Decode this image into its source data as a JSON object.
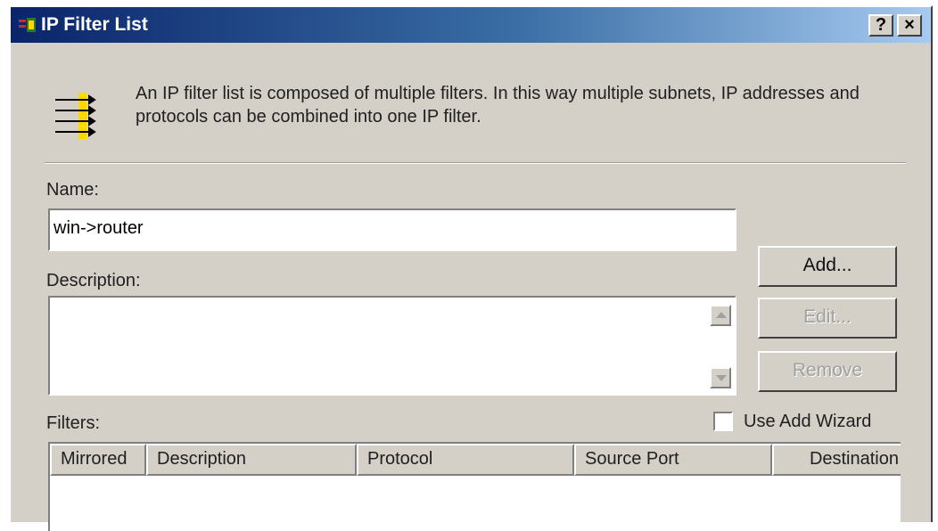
{
  "window": {
    "title": "IP Filter List",
    "help_label": "?",
    "close_label": "×"
  },
  "intro": {
    "text": "An IP filter list is composed of multiple filters. In this way multiple subnets, IP addresses and protocols can be combined into one IP filter.",
    "icon": "filter-list-icon"
  },
  "form": {
    "name_label": "Name:",
    "name_value": "win->router",
    "description_label": "Description:",
    "description_value": "",
    "filters_label": "Filters:"
  },
  "buttons": {
    "add": "Add...",
    "edit": "Edit...",
    "remove": "Remove"
  },
  "wizard": {
    "label": "Use Add Wizard",
    "checked": false
  },
  "table": {
    "columns": [
      "Mirrored",
      "Description",
      "Protocol",
      "Source Port",
      "Destination"
    ],
    "rows": []
  },
  "colors": {
    "titlebar_start": "#0a246a",
    "titlebar_end": "#a6caf0",
    "face": "#d4d0c8",
    "icon_arrow": "#ffd800"
  }
}
